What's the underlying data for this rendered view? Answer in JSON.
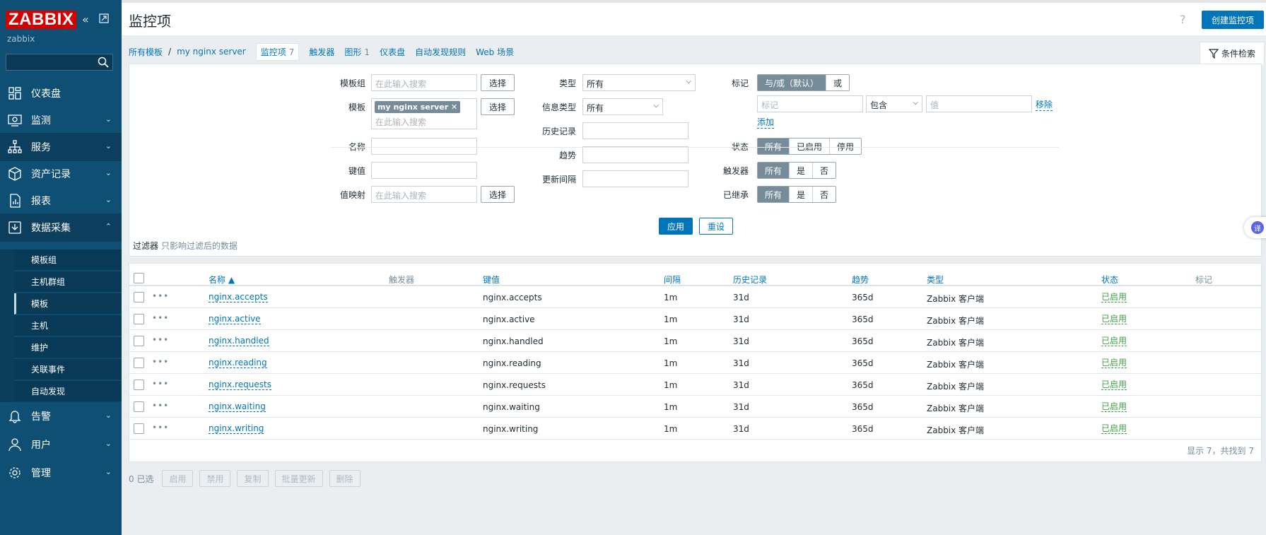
{
  "sidebar": {
    "logo": "ZABBIX",
    "user": "zabbix",
    "search_placeholder": "",
    "items": [
      {
        "label": "仪表盘"
      },
      {
        "label": "监测"
      },
      {
        "label": "服务"
      },
      {
        "label": "资产记录"
      },
      {
        "label": "报表"
      },
      {
        "label": "数据采集"
      },
      {
        "label": "告警"
      },
      {
        "label": "用户"
      },
      {
        "label": "管理"
      }
    ],
    "subitems": [
      {
        "label": "模板组"
      },
      {
        "label": "主机群组"
      },
      {
        "label": "模板"
      },
      {
        "label": "主机"
      },
      {
        "label": "维护"
      },
      {
        "label": "关联事件"
      },
      {
        "label": "自动发现"
      }
    ]
  },
  "header": {
    "title": "监控项",
    "help": "?",
    "create_label": "创建监控项"
  },
  "breadcrumb": {
    "all_templates": "所有模板",
    "sep": "/",
    "template": "my nginx server",
    "items": "监控项",
    "items_count": "7",
    "triggers": "触发器",
    "graphs": "图形",
    "graphs_count": "1",
    "dashboards": "仪表盘",
    "discovery": "自动发现规则",
    "web": "Web 场景"
  },
  "filter": {
    "tab_label": "条件检索",
    "template_groups_label": "模板组",
    "template_groups_placeholder": "在此输入搜索",
    "templates_label": "模板",
    "template_chip": "my nginx server",
    "templates_placeholder": "在此输入搜索",
    "select_label": "选择",
    "name_label": "名称",
    "key_label": "键值",
    "valuemap_label": "值映射",
    "valuemap_placeholder": "在此输入搜索",
    "type_label": "类型",
    "type_value": "所有",
    "info_type_label": "信息类型",
    "info_type_value": "所有",
    "history_label": "历史记录",
    "trends_label": "趋势",
    "update_interval_label": "更新间隔",
    "tags_label": "标记",
    "tag_and_or": "与/或（默认）",
    "tag_or": "或",
    "tag_placeholder": "标记",
    "tag_operator": "包含",
    "tag_value_placeholder": "值",
    "remove_label": "移除",
    "add_label": "添加",
    "state_label": "状态",
    "state_options": [
      "所有",
      "已启用",
      "停用"
    ],
    "triggers_label": "触发器",
    "yesno_options": [
      "所有",
      "是",
      "否"
    ],
    "inherited_label": "已继承",
    "apply_label": "应用",
    "reset_label": "重设",
    "note_title": "过滤器",
    "note_sub": "只影响过滤后的数据"
  },
  "table": {
    "columns": [
      "名称 ▲",
      "触发器",
      "键值",
      "间隔",
      "历史记录",
      "趋势",
      "类型",
      "状态",
      "标记"
    ],
    "rows": [
      {
        "name": "nginx.accepts",
        "key": "nginx.accepts",
        "interval": "1m",
        "history": "31d",
        "trends": "365d",
        "type": "Zabbix 客户端",
        "status": "已启用"
      },
      {
        "name": "nginx.active",
        "key": "nginx.active",
        "interval": "1m",
        "history": "31d",
        "trends": "365d",
        "type": "Zabbix 客户端",
        "status": "已启用"
      },
      {
        "name": "nginx.handled",
        "key": "nginx.handled",
        "interval": "1m",
        "history": "31d",
        "trends": "365d",
        "type": "Zabbix 客户端",
        "status": "已启用"
      },
      {
        "name": "nginx.reading",
        "key": "nginx.reading",
        "interval": "1m",
        "history": "31d",
        "trends": "365d",
        "type": "Zabbix 客户端",
        "status": "已启用"
      },
      {
        "name": "nginx.requests",
        "key": "nginx.requests",
        "interval": "1m",
        "history": "31d",
        "trends": "365d",
        "type": "Zabbix 客户端",
        "status": "已启用"
      },
      {
        "name": "nginx.waiting",
        "key": "nginx.waiting",
        "interval": "1m",
        "history": "31d",
        "trends": "365d",
        "type": "Zabbix 客户端",
        "status": "已启用"
      },
      {
        "name": "nginx.writing",
        "key": "nginx.writing",
        "interval": "1m",
        "history": "31d",
        "trends": "365d",
        "type": "Zabbix 客户端",
        "status": "已启用"
      }
    ],
    "footer": "显示 7，共找到 7"
  },
  "actions": {
    "selected": "0 已选",
    "buttons": [
      "启用",
      "禁用",
      "复制",
      "批量更新",
      "删除"
    ]
  },
  "translate_bubble": "译"
}
